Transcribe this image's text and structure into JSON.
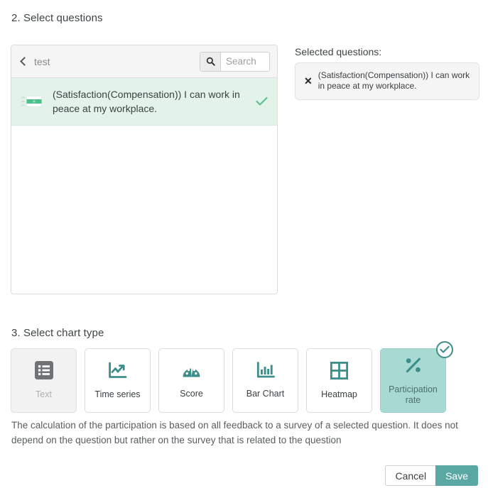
{
  "sections": {
    "questions": {
      "heading": "2. Select questions"
    },
    "chart_type": {
      "heading": "3. Select chart type"
    }
  },
  "questions_panel": {
    "breadcrumb_label": "test",
    "back_icon": "chevron-left-icon",
    "search": {
      "icon": "search-icon",
      "placeholder": "Search",
      "value": ""
    },
    "items": [
      {
        "icon": "table-chart-icon",
        "text": "(Satisfaction(Compensation)) I can work in peace at my workplace.",
        "selected": true,
        "check_icon": "check-icon"
      }
    ]
  },
  "selected_questions": {
    "label": "Selected questions:",
    "items": [
      {
        "remove_icon": "close-icon",
        "remove_glyph": "✕",
        "text": "(Satisfaction(Compensation)) I can work in peace at my workplace."
      }
    ]
  },
  "chart_types": {
    "cards": [
      {
        "id": "text",
        "label": "Text",
        "icon": "list-icon",
        "state": "disabled"
      },
      {
        "id": "time-series",
        "label": "Time series",
        "icon": "line-chart-icon",
        "state": "default"
      },
      {
        "id": "score",
        "label": "Score",
        "icon": "gauge-icon",
        "state": "default"
      },
      {
        "id": "bar-chart",
        "label": "Bar Chart",
        "icon": "bar-chart-icon",
        "state": "default"
      },
      {
        "id": "heatmap",
        "label": "Heatmap",
        "icon": "grid-icon",
        "state": "default"
      },
      {
        "id": "participation-rate",
        "label": "Participation rate",
        "icon": "percent-icon",
        "state": "selected",
        "badge_icon": "check-circle-icon"
      }
    ],
    "description": "The calculation of the participation is based on all feedback to a survey of a selected question. It does not depend on the question but rather on the survey that is related to the question"
  },
  "footer": {
    "cancel_label": "Cancel",
    "save_label": "Save"
  },
  "colors": {
    "teal": "#3d8e8a",
    "teal_button": "#5aa8a4",
    "selected_card_bg": "#a8d9d3",
    "row_selected_bg": "#e4f3ea",
    "green_check": "#5cc08f",
    "disabled_grey": "#6f7376"
  }
}
